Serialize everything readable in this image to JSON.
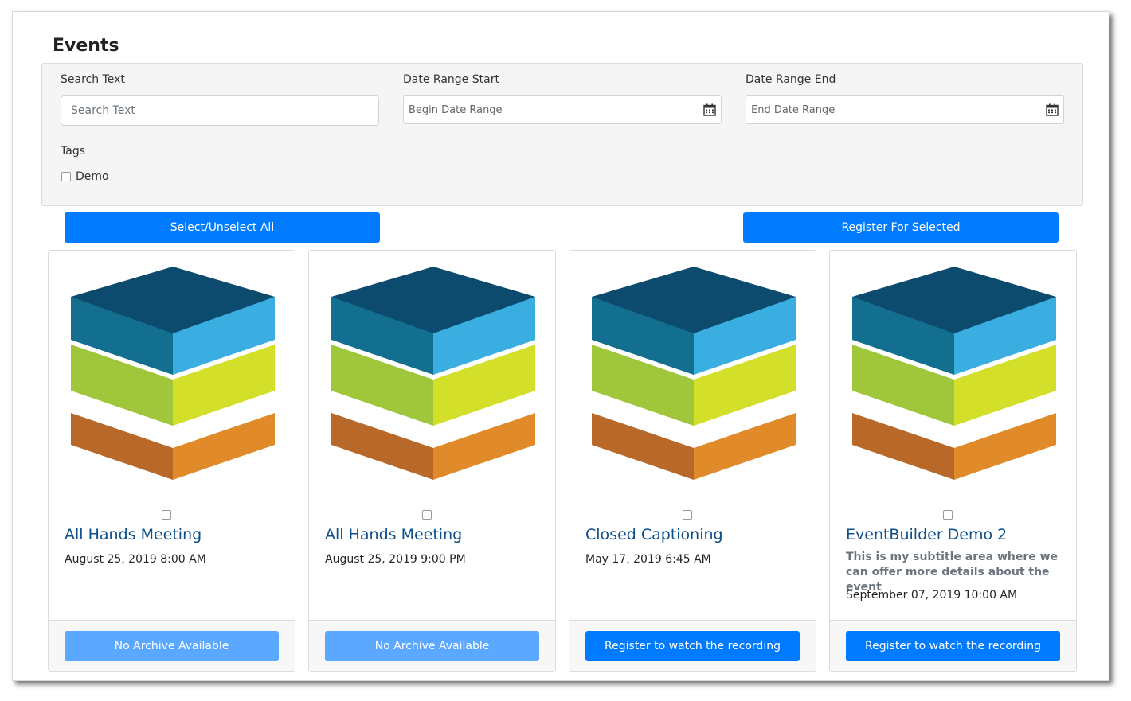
{
  "page": {
    "title": "Events"
  },
  "filters": {
    "search": {
      "label": "Search Text",
      "placeholder": "Search Text"
    },
    "date_start": {
      "label": "Date Range Start",
      "placeholder": "Begin Date Range"
    },
    "date_end": {
      "label": "Date Range End",
      "placeholder": "End Date Range"
    },
    "tags": {
      "label": "Tags",
      "items": [
        {
          "label": "Demo",
          "checked": false
        }
      ]
    }
  },
  "actions": {
    "select_all_label": "Select/Unselect All",
    "register_selected_label": "Register For Selected"
  },
  "events": [
    {
      "title": "All Hands Meeting",
      "subtitle": "",
      "date": "August 25, 2019 8:00 AM",
      "button_label": "No Archive Available",
      "button_enabled": false,
      "checked": false
    },
    {
      "title": "All Hands Meeting",
      "subtitle": "",
      "date": "August 25, 2019 9:00 PM",
      "button_label": "No Archive Available",
      "button_enabled": false,
      "checked": false
    },
    {
      "title": "Closed Captioning",
      "subtitle": "",
      "date": "May 17, 2019 6:45 AM",
      "button_label": "Register to watch the recording",
      "button_enabled": true,
      "checked": false
    },
    {
      "title": "EventBuilder Demo 2",
      "subtitle": "This is my subtitle area where we can offer more details about the event",
      "date": "September 07, 2019 10:00 AM",
      "button_label": "Register to watch the recording",
      "button_enabled": true,
      "checked": false
    }
  ],
  "colors": {
    "primary": "#007bff",
    "primary_disabled": "#5aa8ff",
    "title_link": "#0d4f8b",
    "cube_top": "#0c4a6e",
    "cube_blue_left": "#136f8f",
    "cube_blue_right": "#3aaee0",
    "cube_green_left": "#a0c63c",
    "cube_green_right": "#d4df2a",
    "cube_orange_left": "#b8692a",
    "cube_orange_right": "#e08a2a"
  }
}
